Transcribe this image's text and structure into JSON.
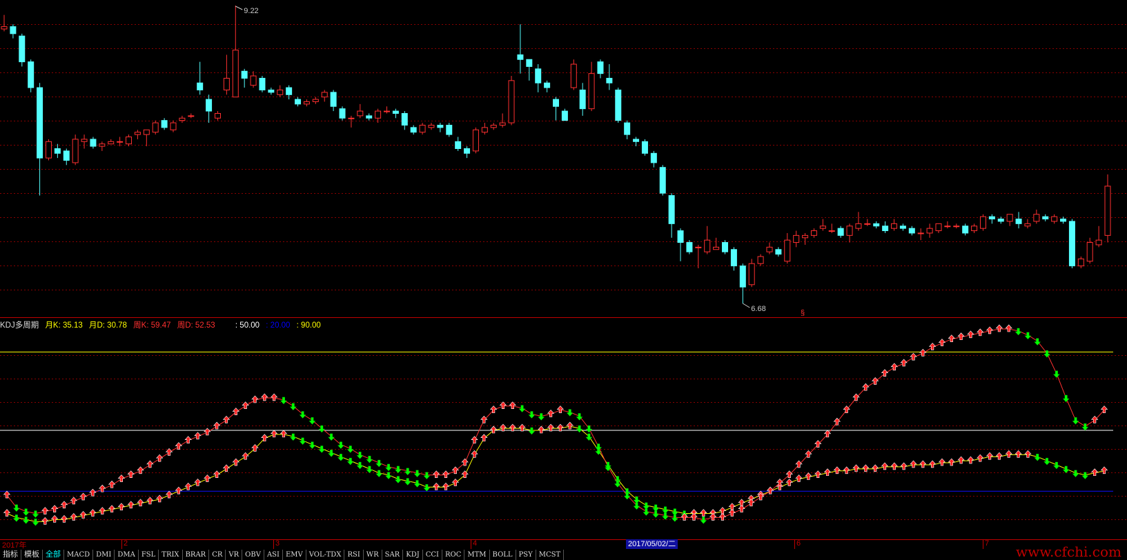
{
  "price_chart": {
    "high_label": "9.22",
    "low_label": "6.68",
    "marker_label": "§",
    "colors": {
      "up": "#ff3030",
      "down": "#54ffff",
      "grid": "#8b0000"
    }
  },
  "indicator": {
    "name": "KDJ多周期",
    "values": [
      {
        "label": "月K: 35.13",
        "color": "#ffff00"
      },
      {
        "label": "月D: 30.78",
        "color": "#ffff00"
      },
      {
        "label": "周K: 59.47",
        "color": "#ff3030"
      },
      {
        "label": "周D: 52.53",
        "color": "#ff3030"
      },
      {
        "label": ": 50.00",
        "color": "#ffffff"
      },
      {
        "label": ": 20.00",
        "color": "#0000ff"
      },
      {
        "label": ": 90.00",
        "color": "#ffff00"
      }
    ]
  },
  "time_axis": {
    "labels": [
      "2017年",
      "2",
      "3",
      "4",
      "6",
      "7"
    ],
    "selected_date": "2017/05/02/二"
  },
  "tabs": [
    "指标",
    "模板",
    "全部",
    "MACD",
    "DMI",
    "DMA",
    "FSL",
    "TRIX",
    "BRAR",
    "CR",
    "VR",
    "OBV",
    "ASI",
    "EMV",
    "VOL-TDX",
    "RSI",
    "WR",
    "SAR",
    "KDJ",
    "CCI",
    "ROC",
    "MTM",
    "BOLL",
    "PSY",
    "MCST"
  ],
  "active_tab": "全部",
  "watermark": "www.cfchi.com",
  "chart_data": {
    "type": "candlestick",
    "candles": [
      [
        9.02,
        9.04,
        9.14,
        9.0
      ],
      [
        9.04,
        8.98,
        9.06,
        8.94
      ],
      [
        8.96,
        8.74,
        8.98,
        8.7
      ],
      [
        8.74,
        8.52,
        8.76,
        8.48
      ],
      [
        8.52,
        7.92,
        8.56,
        7.6
      ],
      [
        7.92,
        8.06,
        8.08,
        7.9
      ],
      [
        8.0,
        7.96,
        8.04,
        7.92
      ],
      [
        7.98,
        7.9,
        8.0,
        7.86
      ],
      [
        7.88,
        8.08,
        8.12,
        7.86
      ],
      [
        8.06,
        8.08,
        8.12,
        8.0
      ],
      [
        8.08,
        8.02,
        8.1,
        8.0
      ],
      [
        8.02,
        8.04,
        8.06,
        7.98
      ],
      [
        8.04,
        8.06,
        8.08,
        8.04
      ],
      [
        8.06,
        8.06,
        8.1,
        8.02
      ],
      [
        8.04,
        8.1,
        8.12,
        8.02
      ],
      [
        8.12,
        8.14,
        8.16,
        8.08
      ],
      [
        8.12,
        8.16,
        8.16,
        8.02
      ],
      [
        8.14,
        8.22,
        8.24,
        8.12
      ],
      [
        8.24,
        8.18,
        8.26,
        8.16
      ],
      [
        8.16,
        8.22,
        8.24,
        8.14
      ],
      [
        8.24,
        8.26,
        8.28,
        8.22
      ],
      [
        8.28,
        8.28,
        8.3,
        8.26
      ],
      [
        8.56,
        8.5,
        8.74,
        8.46
      ],
      [
        8.42,
        8.32,
        8.46,
        8.22
      ],
      [
        8.26,
        8.3,
        8.32,
        8.24
      ],
      [
        8.5,
        8.6,
        8.8,
        8.46
      ],
      [
        8.44,
        8.84,
        9.22,
        8.44
      ],
      [
        8.66,
        8.6,
        8.68,
        8.52
      ],
      [
        8.54,
        8.62,
        8.66,
        8.52
      ],
      [
        8.6,
        8.5,
        8.62,
        8.48
      ],
      [
        8.5,
        8.48,
        8.52,
        8.46
      ],
      [
        8.46,
        8.5,
        8.54,
        8.44
      ],
      [
        8.52,
        8.46,
        8.54,
        8.42
      ],
      [
        8.42,
        8.38,
        8.44,
        8.36
      ],
      [
        8.38,
        8.4,
        8.42,
        8.36
      ],
      [
        8.4,
        8.42,
        8.44,
        8.38
      ],
      [
        8.44,
        8.48,
        8.5,
        8.4
      ],
      [
        8.48,
        8.36,
        8.5,
        8.32
      ],
      [
        8.34,
        8.26,
        8.36,
        8.24
      ],
      [
        8.26,
        8.26,
        8.28,
        8.18
      ],
      [
        8.28,
        8.32,
        8.38,
        8.26
      ],
      [
        8.28,
        8.26,
        8.3,
        8.24
      ],
      [
        8.26,
        8.32,
        8.34,
        8.22
      ],
      [
        8.32,
        8.32,
        8.36,
        8.3
      ],
      [
        8.32,
        8.3,
        8.34,
        8.26
      ],
      [
        8.3,
        8.2,
        8.32,
        8.16
      ],
      [
        8.18,
        8.14,
        8.2,
        8.12
      ],
      [
        8.14,
        8.2,
        8.22,
        8.12
      ],
      [
        8.18,
        8.2,
        8.22,
        8.16
      ],
      [
        8.2,
        8.18,
        8.22,
        8.14
      ],
      [
        8.2,
        8.12,
        8.22,
        8.1
      ],
      [
        8.06,
        8.0,
        8.1,
        7.98
      ],
      [
        8.0,
        7.96,
        8.02,
        7.92
      ],
      [
        7.98,
        8.16,
        8.18,
        7.96
      ],
      [
        8.14,
        8.18,
        8.22,
        8.12
      ],
      [
        8.18,
        8.2,
        8.22,
        8.16
      ],
      [
        8.2,
        8.22,
        8.3,
        8.18
      ],
      [
        8.22,
        8.58,
        8.62,
        8.2
      ],
      [
        8.8,
        8.76,
        9.06,
        8.64
      ],
      [
        8.76,
        8.7,
        8.74,
        8.58
      ],
      [
        8.68,
        8.56,
        8.72,
        8.48
      ],
      [
        8.56,
        8.52,
        8.58,
        8.48
      ],
      [
        8.42,
        8.36,
        8.44,
        8.24
      ],
      [
        8.32,
        8.24,
        8.34,
        8.24
      ],
      [
        8.52,
        8.72,
        8.76,
        8.5
      ],
      [
        8.5,
        8.34,
        8.56,
        8.28
      ],
      [
        8.34,
        8.64,
        8.74,
        8.32
      ],
      [
        8.74,
        8.64,
        8.76,
        8.6
      ],
      [
        8.6,
        8.56,
        8.72,
        8.5
      ],
      [
        8.5,
        8.24,
        8.52,
        8.22
      ],
      [
        8.22,
        8.12,
        8.24,
        8.08
      ],
      [
        8.08,
        8.06,
        8.1,
        8.02
      ],
      [
        8.06,
        7.96,
        8.08,
        7.94
      ],
      [
        7.96,
        7.88,
        7.98,
        7.84
      ],
      [
        7.84,
        7.62,
        7.86,
        7.6
      ],
      [
        7.6,
        7.36,
        7.62,
        7.24
      ],
      [
        7.3,
        7.2,
        7.32,
        7.04
      ],
      [
        7.2,
        7.12,
        7.22,
        7.1
      ],
      [
        7.16,
        7.16,
        7.18,
        6.98
      ],
      [
        7.12,
        7.22,
        7.34,
        7.1
      ],
      [
        7.14,
        7.16,
        7.24,
        7.14
      ],
      [
        7.2,
        7.12,
        7.22,
        7.1
      ],
      [
        7.14,
        7.0,
        7.16,
        6.96
      ],
      [
        7.0,
        6.82,
        7.02,
        6.68
      ],
      [
        6.84,
        7.02,
        7.06,
        6.82
      ],
      [
        7.02,
        7.08,
        7.1,
        7.0
      ],
      [
        7.12,
        7.16,
        7.2,
        7.1
      ],
      [
        7.14,
        7.1,
        7.16,
        7.08
      ],
      [
        7.04,
        7.22,
        7.28,
        7.02
      ],
      [
        7.2,
        7.26,
        7.3,
        7.16
      ],
      [
        7.24,
        7.26,
        7.28,
        7.18
      ],
      [
        7.26,
        7.3,
        7.32,
        7.24
      ],
      [
        7.32,
        7.34,
        7.4,
        7.3
      ],
      [
        7.3,
        7.3,
        7.36,
        7.28
      ],
      [
        7.32,
        7.26,
        7.34,
        7.24
      ],
      [
        7.26,
        7.34,
        7.36,
        7.2
      ],
      [
        7.32,
        7.36,
        7.46,
        7.3
      ],
      [
        7.36,
        7.36,
        7.4,
        7.34
      ],
      [
        7.36,
        7.34,
        7.38,
        7.32
      ],
      [
        7.34,
        7.3,
        7.38,
        7.28
      ],
      [
        7.32,
        7.36,
        7.4,
        7.3
      ],
      [
        7.34,
        7.32,
        7.36,
        7.3
      ],
      [
        7.32,
        7.28,
        7.34,
        7.26
      ],
      [
        7.28,
        7.28,
        7.32,
        7.22
      ],
      [
        7.28,
        7.32,
        7.36,
        7.24
      ],
      [
        7.3,
        7.36,
        7.36,
        7.28
      ],
      [
        7.34,
        7.34,
        7.38,
        7.32
      ],
      [
        7.34,
        7.34,
        7.36,
        7.32
      ],
      [
        7.34,
        7.28,
        7.36,
        7.26
      ],
      [
        7.3,
        7.34,
        7.36,
        7.28
      ],
      [
        7.32,
        7.42,
        7.44,
        7.3
      ],
      [
        7.42,
        7.4,
        7.44,
        7.36
      ],
      [
        7.4,
        7.38,
        7.42,
        7.36
      ],
      [
        7.38,
        7.44,
        7.44,
        7.34
      ],
      [
        7.4,
        7.36,
        7.46,
        7.32
      ],
      [
        7.34,
        7.36,
        7.4,
        7.32
      ],
      [
        7.38,
        7.44,
        7.48,
        7.36
      ],
      [
        7.42,
        7.4,
        7.44,
        7.38
      ],
      [
        7.38,
        7.42,
        7.44,
        7.36
      ],
      [
        7.4,
        7.38,
        7.42,
        7.36
      ],
      [
        7.38,
        7.0,
        7.4,
        6.98
      ],
      [
        7.0,
        7.06,
        7.08,
        6.98
      ],
      [
        7.04,
        7.2,
        7.24,
        7.02
      ],
      [
        7.18,
        7.22,
        7.34,
        7.16
      ],
      [
        7.26,
        7.68,
        7.78,
        7.2
      ]
    ],
    "kdj_weekly_k": [
      18,
      12,
      10,
      9,
      10,
      11,
      13,
      15,
      17,
      19,
      21,
      23,
      26,
      28,
      30,
      33,
      36,
      39,
      42,
      45,
      47,
      49,
      52,
      55,
      59,
      62,
      65,
      66,
      66,
      65,
      62,
      58,
      55,
      51,
      47,
      43,
      41,
      38,
      36,
      34,
      32,
      31,
      30,
      29,
      28,
      28,
      28,
      30,
      34,
      45,
      55,
      60,
      62,
      62,
      61,
      58,
      57,
      58,
      60,
      59,
      57,
      51,
      42,
      32,
      24,
      18,
      13,
      10,
      9,
      8,
      7,
      7,
      7,
      6,
      7,
      7,
      9,
      11,
      14,
      17,
      20,
      24,
      28,
      33,
      38,
      43,
      48,
      54,
      60,
      66,
      71,
      74,
      78,
      81,
      83,
      86,
      88,
      91,
      93,
      95,
      96,
      97,
      98,
      99,
      100,
      100,
      99,
      97,
      94,
      88,
      78,
      66,
      55,
      52,
      55,
      60
    ],
    "kdj_weekly_d": [
      9,
      7,
      6,
      5,
      5,
      6,
      6,
      7,
      8,
      9,
      10,
      11,
      12,
      13,
      14,
      15,
      16,
      18,
      20,
      22,
      24,
      26,
      28,
      31,
      34,
      37,
      41,
      46,
      48,
      48,
      47,
      45,
      43,
      41,
      39,
      37,
      35,
      33,
      31,
      29,
      28,
      26,
      25,
      24,
      22,
      22,
      22,
      24,
      28,
      38,
      46,
      50,
      51,
      51,
      51,
      50,
      50,
      51,
      51,
      52,
      51,
      47,
      40,
      33,
      26,
      20,
      16,
      13,
      12,
      11,
      10,
      9,
      9,
      9,
      9,
      10,
      12,
      14,
      16,
      18,
      20,
      22,
      24,
      26,
      27,
      28,
      29,
      30,
      30,
      31,
      31,
      31,
      32,
      32,
      32,
      33,
      33,
      33,
      34,
      34,
      35,
      35,
      36,
      37,
      37,
      38,
      38,
      38,
      37,
      35,
      33,
      31,
      29,
      28,
      29,
      30
    ]
  }
}
